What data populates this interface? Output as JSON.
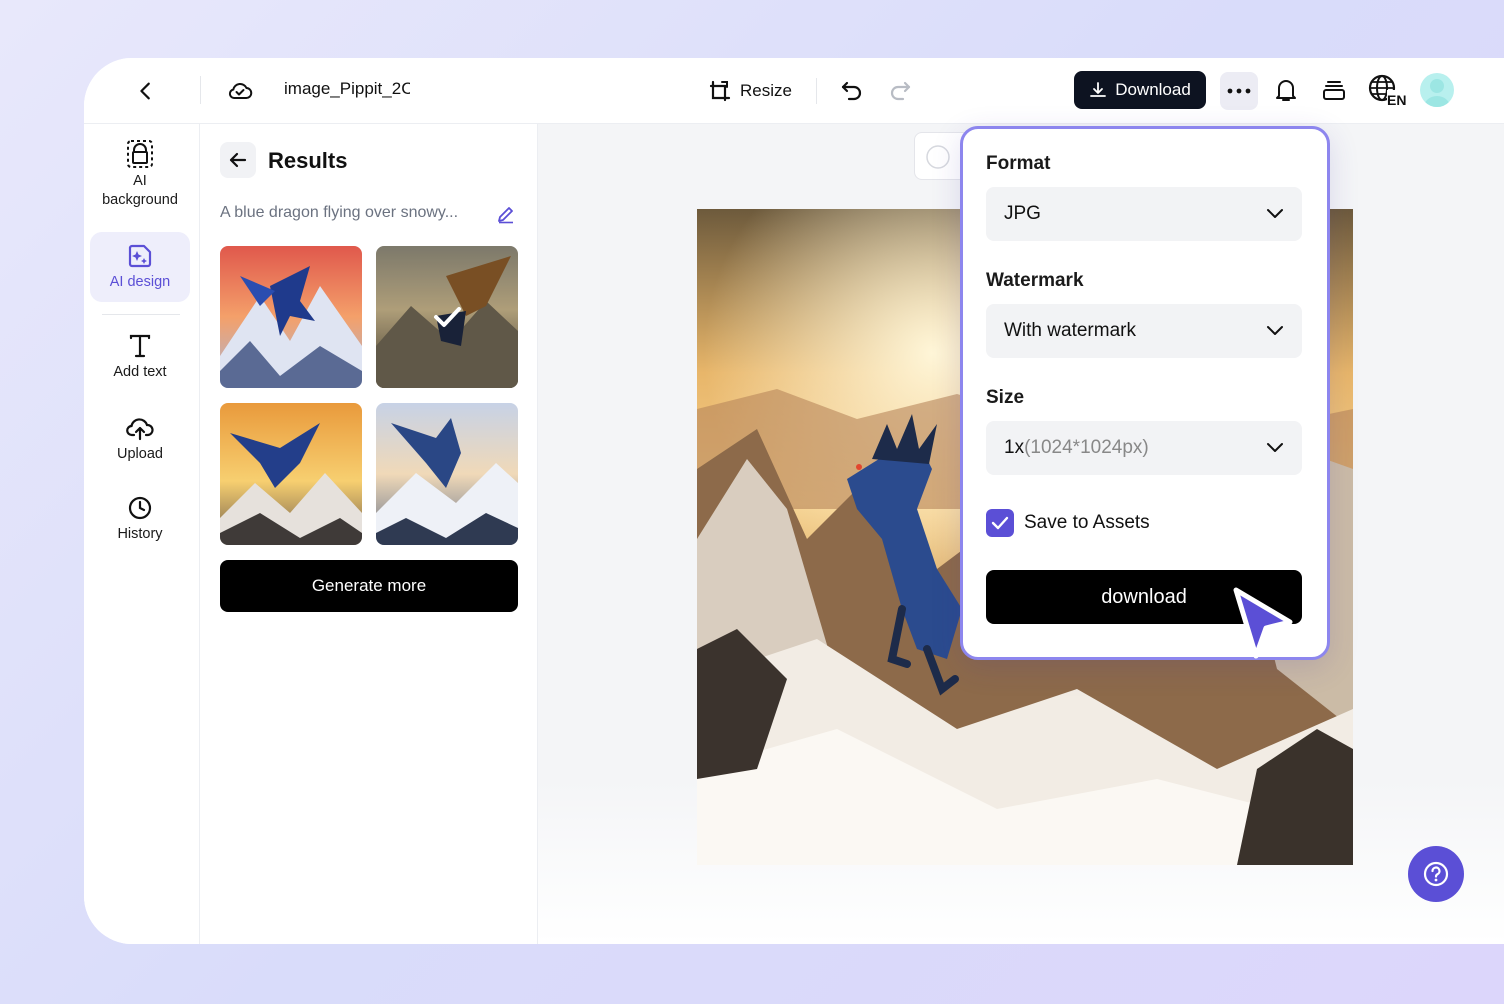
{
  "topbar": {
    "filename": "image_Pippit_2C",
    "resize_label": "Resize",
    "download_label": "Download",
    "language": "EN"
  },
  "rail": {
    "items": [
      {
        "label": "AI background",
        "icon": "ai-background-icon"
      },
      {
        "label": "AI design",
        "icon": "ai-design-icon"
      },
      {
        "label": "Add text",
        "icon": "text-icon"
      },
      {
        "label": "Upload",
        "icon": "cloud-upload-icon"
      },
      {
        "label": "History",
        "icon": "clock-icon"
      }
    ],
    "active": "AI design"
  },
  "panel": {
    "title": "Results",
    "prompt": "A blue dragon flying over snowy...",
    "generate_more_label": "Generate more",
    "selected_thumb": 2
  },
  "popover": {
    "format_label": "Format",
    "format_value": "JPG",
    "watermark_label": "Watermark",
    "watermark_value": "With watermark",
    "size_label": "Size",
    "size_value_main": "1x",
    "size_value_detail": "(1024*1024px)",
    "save_label": "Save to Assets",
    "save_checked": true,
    "download_label": "download"
  },
  "colors": {
    "accent": "#5b4fd6",
    "popover_border": "#8d86ee",
    "dark": "#0d1321"
  }
}
